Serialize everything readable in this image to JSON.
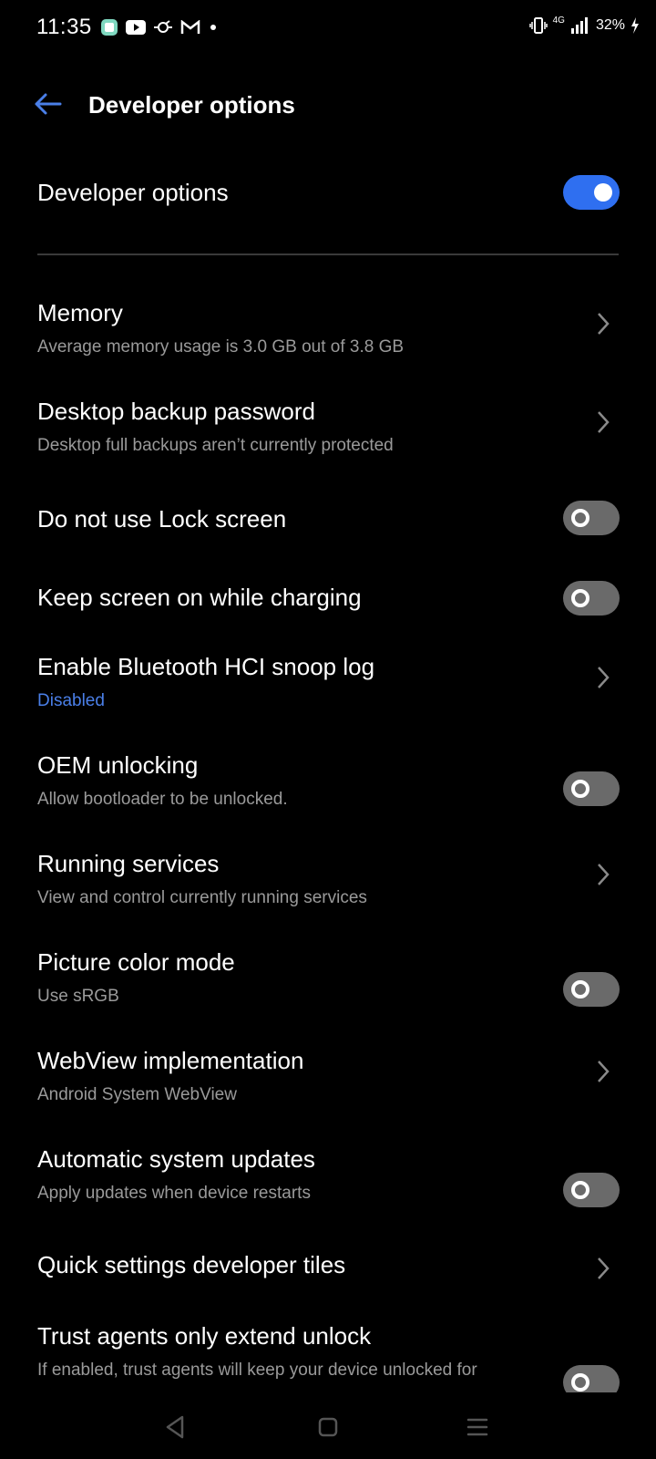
{
  "status_bar": {
    "time": "11:35",
    "notification_icons": [
      "app-icon",
      "youtube-icon",
      "cast-icon",
      "gmail-icon",
      "dot-icon"
    ],
    "network": "4G",
    "battery": "32%"
  },
  "header": {
    "title": "Developer options"
  },
  "master_toggle": {
    "label": "Developer options",
    "state": "on"
  },
  "colors": {
    "accent": "#2f6ff0",
    "link": "#4a7fe8",
    "background": "#000000",
    "toggle_off": "#6a6a6a"
  },
  "items": [
    {
      "title": "Memory",
      "subtitle": "Average memory usage is 3.0 GB out of 3.8 GB",
      "control": "chevron"
    },
    {
      "title": "Desktop backup password",
      "subtitle": "Desktop full backups aren’t currently protected",
      "control": "chevron"
    },
    {
      "title": "Do not use Lock screen",
      "subtitle": "",
      "control": "toggle-off"
    },
    {
      "title": "Keep screen on while charging",
      "subtitle": "",
      "control": "toggle-off"
    },
    {
      "title": "Enable Bluetooth HCI snoop log",
      "subtitle": "Disabled",
      "control": "chevron"
    },
    {
      "title": "OEM unlocking",
      "subtitle": "Allow bootloader to be unlocked.",
      "control": "toggle-off"
    },
    {
      "title": "Running services",
      "subtitle": "View and control currently running services",
      "control": "chevron"
    },
    {
      "title": "Picture color mode",
      "subtitle": "Use sRGB",
      "control": "toggle-off"
    },
    {
      "title": "WebView implementation",
      "subtitle": "Android System WebView",
      "control": "chevron"
    },
    {
      "title": "Automatic system updates",
      "subtitle": "Apply updates when device restarts",
      "control": "toggle-off"
    },
    {
      "title": "Quick settings developer tiles",
      "subtitle": "",
      "control": "chevron"
    },
    {
      "title": "Trust agents only extend unlock",
      "subtitle": "If enabled, trust agents will keep your device unlocked for",
      "control": "toggle-off"
    }
  ],
  "nav_bar": {
    "buttons": [
      "back-icon",
      "home-icon",
      "recents-icon"
    ]
  }
}
